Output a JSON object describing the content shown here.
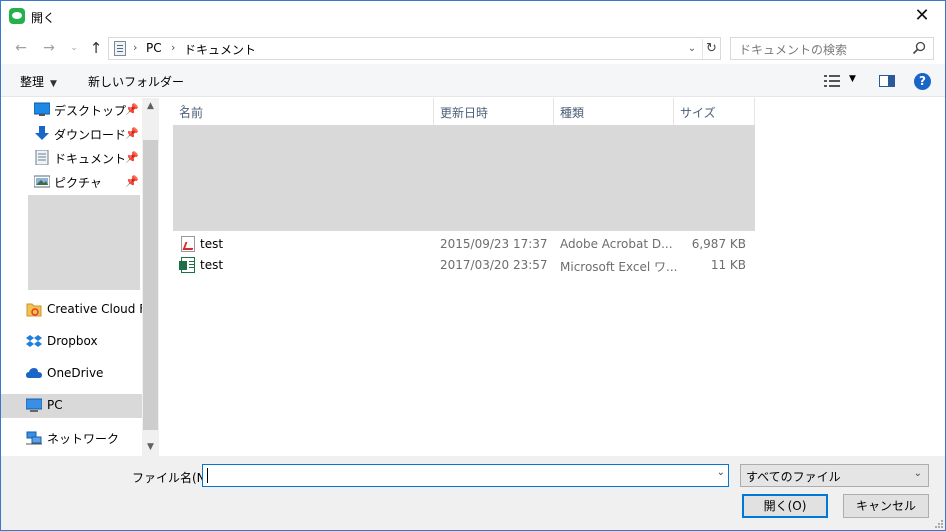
{
  "window": {
    "title": "開く",
    "close_label": "✕"
  },
  "nav": {
    "back_icon": "arrow-left-icon",
    "forward_icon": "arrow-right-icon",
    "recent_icon": "chevron-down-icon",
    "up_icon": "arrow-up-icon"
  },
  "address": {
    "crumbs": [
      "PC",
      "ドキュメント"
    ]
  },
  "search": {
    "placeholder": "ドキュメントの検索"
  },
  "toolbar": {
    "organize_label": "整理",
    "new_folder_label": "新しいフォルダー"
  },
  "sidebar": {
    "quick_access": [
      {
        "label": "デスクトップ",
        "icon": "desktop-icon",
        "pinned": true
      },
      {
        "label": "ダウンロード",
        "icon": "download-icon",
        "pinned": true
      },
      {
        "label": "ドキュメント",
        "icon": "document-icon",
        "pinned": true
      },
      {
        "label": "ピクチャ",
        "icon": "pictures-icon",
        "pinned": true
      }
    ],
    "locations": [
      {
        "label": "Creative Cloud File",
        "icon": "creative-cloud-icon",
        "selected": false
      },
      {
        "label": "Dropbox",
        "icon": "dropbox-icon",
        "selected": false
      },
      {
        "label": "OneDrive",
        "icon": "onedrive-icon",
        "selected": false
      },
      {
        "label": "PC",
        "icon": "pc-icon",
        "selected": true
      },
      {
        "label": "ネットワーク",
        "icon": "network-icon",
        "selected": false
      }
    ]
  },
  "filelist": {
    "columns": [
      "名前",
      "更新日時",
      "種類",
      "サイズ"
    ],
    "rows": [
      {
        "name": "test",
        "icon": "pdf-file-icon",
        "modified": "2015/09/23 17:37",
        "type": "Adobe Acrobat D...",
        "size": "6,987 KB"
      },
      {
        "name": "test",
        "icon": "excel-file-icon",
        "modified": "2017/03/20 23:57",
        "type": "Microsoft Excel ワ...",
        "size": "11 KB"
      }
    ]
  },
  "footer": {
    "filename_label": "ファイル名(N):",
    "filename_value": "",
    "filetype_value": "すべてのファイル",
    "open_label": "開く(O)",
    "cancel_label": "キャンセル"
  },
  "colors": {
    "accent": "#0078d7",
    "selected_bg": "#d9d9d9",
    "header_text": "#4c607a"
  }
}
